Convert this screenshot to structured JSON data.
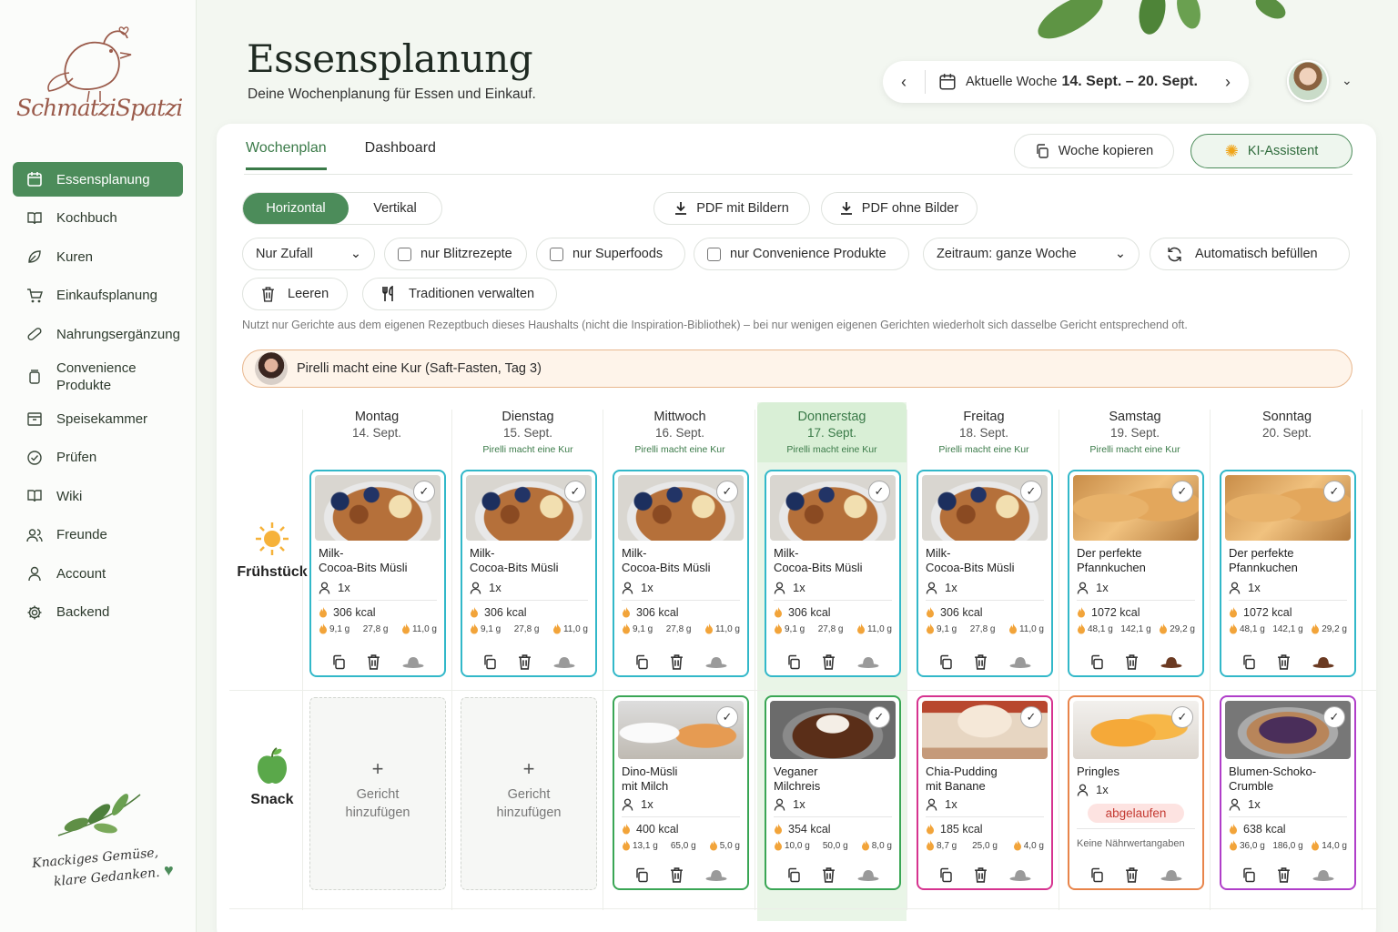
{
  "brand": {
    "name": "SchmatziSpatzi",
    "motto_line1": "Knackiges Gemüse,",
    "motto_line2": "klare Gedanken."
  },
  "sidebar": {
    "items": [
      {
        "label": "Essensplanung",
        "icon": "calendar-icon",
        "active": true
      },
      {
        "label": "Kochbuch",
        "icon": "book-icon"
      },
      {
        "label": "Kuren",
        "icon": "leaf-icon"
      },
      {
        "label": "Einkaufsplanung",
        "icon": "cart-icon"
      },
      {
        "label": "Nahrungsergänzung",
        "icon": "pill-icon"
      },
      {
        "label": "Convenience Produkte",
        "icon": "jar-icon"
      },
      {
        "label": "Speisekammer",
        "icon": "pantry-icon"
      },
      {
        "label": "Prüfen",
        "icon": "check-circle-icon"
      },
      {
        "label": "Wiki",
        "icon": "book-open-icon"
      },
      {
        "label": "Freunde",
        "icon": "users-icon"
      },
      {
        "label": "Account",
        "icon": "user-icon"
      },
      {
        "label": "Backend",
        "icon": "gear-icon"
      }
    ]
  },
  "header": {
    "title": "Essensplanung",
    "subtitle": "Deine Wochenplanung für Essen und Einkauf.",
    "week_prefix": "Aktuelle Woche",
    "week_range": "14. Sept. – 20. Sept."
  },
  "tabs": [
    {
      "label": "Wochenplan",
      "active": true
    },
    {
      "label": "Dashboard"
    }
  ],
  "actions": {
    "copy_week": "Woche kopieren",
    "ki": "KI-Assistent"
  },
  "view_toggle": {
    "horizontal": "Horizontal",
    "vertical": "Vertikal"
  },
  "pdf": {
    "with_images": "PDF mit Bildern",
    "without_images": "PDF ohne Bilder"
  },
  "filters": {
    "random": "Nur Zufall",
    "blitz": "nur Blitzrezepte",
    "superfoods": "nur Superfoods",
    "convenience": "nur Convenience Produkte",
    "zeitraum": "Zeitraum: ganze Woche",
    "autofill": "Automatisch befüllen",
    "clear": "Leeren",
    "traditions": "Traditionen verwalten"
  },
  "note": "Nutzt nur Gerichte aus dem eigenen Rezeptbuch dieses Haushalts (nicht die Inspiration-Bibliothek) – bei nur wenigen eigenen Gerichten wiederholt sich dasselbe Gericht entsprechend oft.",
  "kur_banner": "Pirelli macht eine Kur (Saft-Fasten, Tag 3)",
  "days": [
    {
      "name": "Montag",
      "date": "14. Sept.",
      "kur": ""
    },
    {
      "name": "Dienstag",
      "date": "15. Sept.",
      "kur": "Pirelli macht eine Kur"
    },
    {
      "name": "Mittwoch",
      "date": "16. Sept.",
      "kur": "Pirelli macht eine Kur"
    },
    {
      "name": "Donnerstag",
      "date": "17. Sept.",
      "kur": "Pirelli macht eine Kur",
      "today": true
    },
    {
      "name": "Freitag",
      "date": "18. Sept.",
      "kur": "Pirelli macht eine Kur"
    },
    {
      "name": "Samstag",
      "date": "19. Sept.",
      "kur": "Pirelli macht eine Kur"
    },
    {
      "name": "Sonntag",
      "date": "20. Sept.",
      "kur": ""
    }
  ],
  "meals": {
    "breakfast": "Frühstück",
    "snack": "Snack",
    "add_line1": "Gericht",
    "add_line2": "hinzufügen"
  },
  "breakfast": [
    {
      "name1": "Milk-",
      "name2": "Cocoa-Bits Müsli",
      "persons": "1x",
      "kcal": "306 kcal",
      "m1": "9,1 g",
      "m2": "27,8 g",
      "m3": "11,0 g",
      "food": "food1"
    },
    {
      "name1": "Milk-",
      "name2": "Cocoa-Bits Müsli",
      "persons": "1x",
      "kcal": "306 kcal",
      "m1": "9,1 g",
      "m2": "27,8 g",
      "m3": "11,0 g",
      "food": "food1"
    },
    {
      "name1": "Milk-",
      "name2": "Cocoa-Bits Müsli",
      "persons": "1x",
      "kcal": "306 kcal",
      "m1": "9,1 g",
      "m2": "27,8 g",
      "m3": "11,0 g",
      "food": "food1"
    },
    {
      "name1": "Milk-",
      "name2": "Cocoa-Bits Müsli",
      "persons": "1x",
      "kcal": "306 kcal",
      "m1": "9,1 g",
      "m2": "27,8 g",
      "m3": "11,0 g",
      "food": "food1"
    },
    {
      "name1": "Milk-",
      "name2": "Cocoa-Bits Müsli",
      "persons": "1x",
      "kcal": "306 kcal",
      "m1": "9,1 g",
      "m2": "27,8 g",
      "m3": "11,0 g",
      "food": "food1"
    },
    {
      "name1": "Der perfekte",
      "name2": "Pfannkuchen",
      "persons": "1x",
      "kcal": "1072 kcal",
      "m1": "48,1 g",
      "m2": "142,1 g",
      "m3": "29,2 g",
      "food": "food2"
    },
    {
      "name1": "Der perfekte",
      "name2": "Pfannkuchen",
      "persons": "1x",
      "kcal": "1072 kcal",
      "m1": "48,1 g",
      "m2": "142,1 g",
      "m3": "29,2 g",
      "food": "food2"
    }
  ],
  "snacks": [
    {
      "name1": "Dino-Müsli",
      "name2": "mit Milch",
      "persons": "1x",
      "kcal": "400 kcal",
      "m1": "13,1 g",
      "m2": "65,0 g",
      "m3": "5,0 g",
      "food": "food3",
      "color": "#3aa655"
    },
    {
      "name1": "Veganer",
      "name2": "Milchreis",
      "persons": "1x",
      "kcal": "354 kcal",
      "m1": "10,0 g",
      "m2": "50,0 g",
      "m3": "8,0 g",
      "food": "food4",
      "color": "#3aa655"
    },
    {
      "name1": "Chia-Pudding",
      "name2": "mit Banane",
      "persons": "1x",
      "kcal": "185 kcal",
      "m1": "8,7 g",
      "m2": "25,0 g",
      "m3": "4,0 g",
      "food": "food5",
      "color": "#d6338f"
    },
    {
      "name1": "Pringles",
      "persons": "1x",
      "expired": "abgelaufen",
      "nonut": "Keine Nährwertangaben",
      "food": "food6",
      "color": "#e8844a"
    },
    {
      "name1": "Blumen-Schoko-",
      "name2": "Crumble",
      "persons": "1x",
      "kcal": "638 kcal",
      "m1": "36,0 g",
      "m2": "186,0 g",
      "m3": "14,0 g",
      "food": "food7",
      "color": "#b03ec9"
    }
  ],
  "colors": {
    "accent": "#4c8c5a",
    "breakfast_border": "#32b8c9",
    "hat_brown": "#6b3a22",
    "hat_gray": "#8c8c8c"
  }
}
